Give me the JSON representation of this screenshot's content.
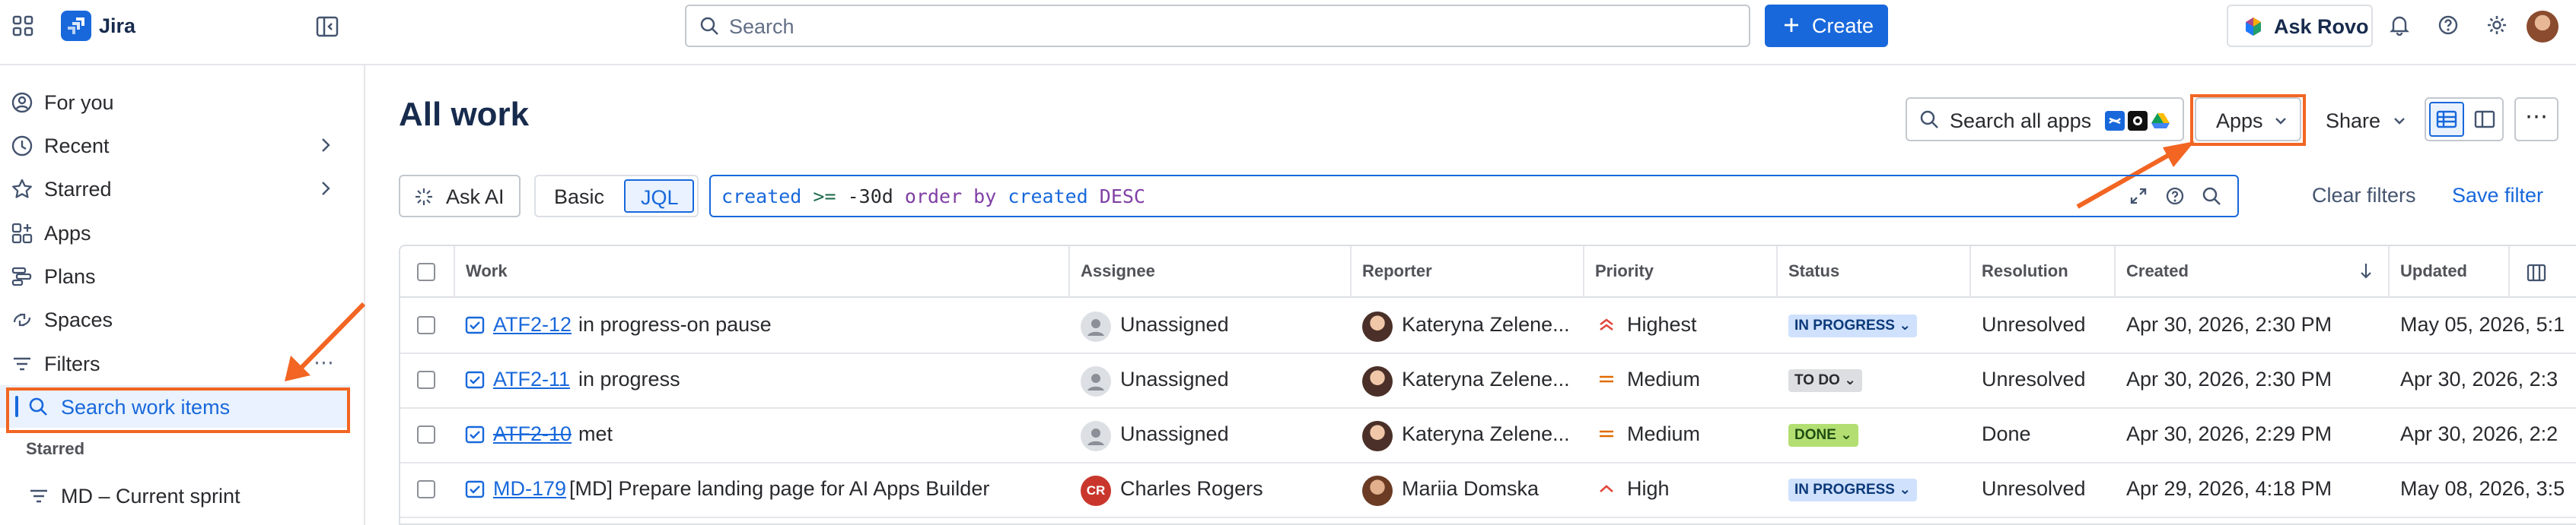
{
  "app": {
    "title": "Jira"
  },
  "topbar": {
    "search_placeholder": "Search",
    "create_label": "Create",
    "ask_rovo_label": "Ask Rovo"
  },
  "sidebar": {
    "items": [
      {
        "label": "For you",
        "icon": "for-you-icon"
      },
      {
        "label": "Recent",
        "icon": "clock-icon"
      },
      {
        "label": "Starred",
        "icon": "star-icon"
      },
      {
        "label": "Apps",
        "icon": "apps-icon"
      },
      {
        "label": "Plans",
        "icon": "plans-icon"
      },
      {
        "label": "Spaces",
        "icon": "spaces-icon"
      },
      {
        "label": "Filters",
        "icon": "filter-icon"
      },
      {
        "label": "Search work items",
        "icon": "search-icon"
      }
    ],
    "starred_heading": "Starred",
    "starred_items": [
      {
        "label": "MD – Current sprint"
      }
    ]
  },
  "main": {
    "title": "All work",
    "search_all_apps_label": "Search all apps",
    "apps_label": "Apps",
    "share_label": "Share",
    "ask_ai_label": "Ask AI",
    "mode_basic": "Basic",
    "mode_jql": "JQL",
    "jql": {
      "field1": "created",
      "op1": ">=",
      "value1": "-30d",
      "order": "order by",
      "field2": "created",
      "dir": "DESC"
    },
    "clear_filters_label": "Clear filters",
    "save_filter_label": "Save filter"
  },
  "table": {
    "columns": [
      "Work",
      "Assignee",
      "Reporter",
      "Priority",
      "Status",
      "Resolution",
      "Created",
      "Updated"
    ],
    "rows": [
      {
        "key": "ATF2-12",
        "summary": "in progress-on pause",
        "assignee": "Unassigned",
        "reporter": "Kateryna Zelene...",
        "priority": "Highest",
        "status": "IN PROGRESS",
        "resolution": "Unresolved",
        "created": "Apr 30, 2026, 2:30 PM",
        "updated": "May 05, 2026, 5:1"
      },
      {
        "key": "ATF2-11",
        "summary": "in progress",
        "assignee": "Unassigned",
        "reporter": "Kateryna Zelene...",
        "priority": "Medium",
        "status": "TO DO",
        "resolution": "Unresolved",
        "created": "Apr 30, 2026, 2:30 PM",
        "updated": "Apr 30, 2026, 2:3"
      },
      {
        "key": "ATF2-10",
        "summary": "met",
        "assignee": "Unassigned",
        "reporter": "Kateryna Zelene...",
        "priority": "Medium",
        "status": "DONE",
        "resolution": "Done",
        "created": "Apr 30, 2026, 2:29 PM",
        "updated": "Apr 30, 2026, 2:2"
      },
      {
        "key": "MD-179",
        "summary": "[MD] Prepare landing page for AI Apps Builder",
        "assignee": "Charles Rogers",
        "assignee_initials": "CR",
        "reporter": "Mariia Domska",
        "priority": "High",
        "status": "IN PROGRESS",
        "resolution": "Unresolved",
        "created": "Apr 29, 2026, 4:18 PM",
        "updated": "May 08, 2026, 3:5"
      }
    ]
  },
  "colors": {
    "brand": "#1868db",
    "annotation": "#f26522",
    "in_progress_bg": "#cfe1fd",
    "todo_bg": "#dddee1",
    "done_bg": "#b3df72"
  }
}
